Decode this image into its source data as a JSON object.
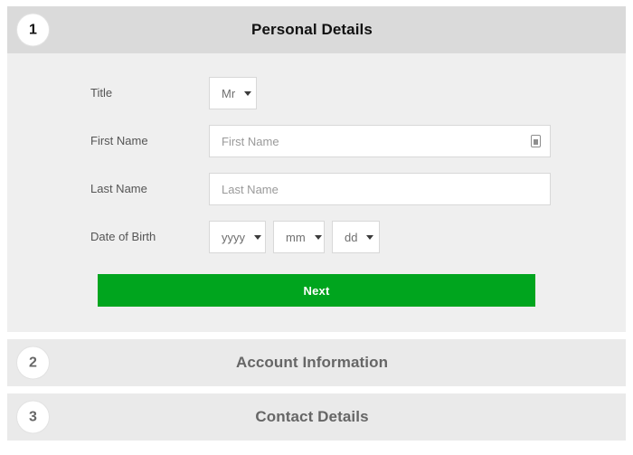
{
  "sections": [
    {
      "number": "1",
      "title": "Personal Details",
      "state": "active"
    },
    {
      "number": "2",
      "title": "Account Information",
      "state": "inactive"
    },
    {
      "number": "3",
      "title": "Contact Details",
      "state": "inactive"
    }
  ],
  "form": {
    "title_label": "Title",
    "title_value": "Mr",
    "first_name_label": "First Name",
    "first_name_value": "",
    "first_name_placeholder": "First Name",
    "first_name_icon": "autofill-icon",
    "last_name_label": "Last Name",
    "last_name_value": "",
    "last_name_placeholder": "Last Name",
    "dob_label": "Date of Birth",
    "dob_year_value": "yyyy",
    "dob_month_value": "mm",
    "dob_day_value": "dd",
    "next_label": "Next"
  },
  "colors": {
    "accent_green": "#00a51e",
    "header_active": "#dadada",
    "header_inactive": "#eaeaea",
    "panel": "#efefef"
  }
}
